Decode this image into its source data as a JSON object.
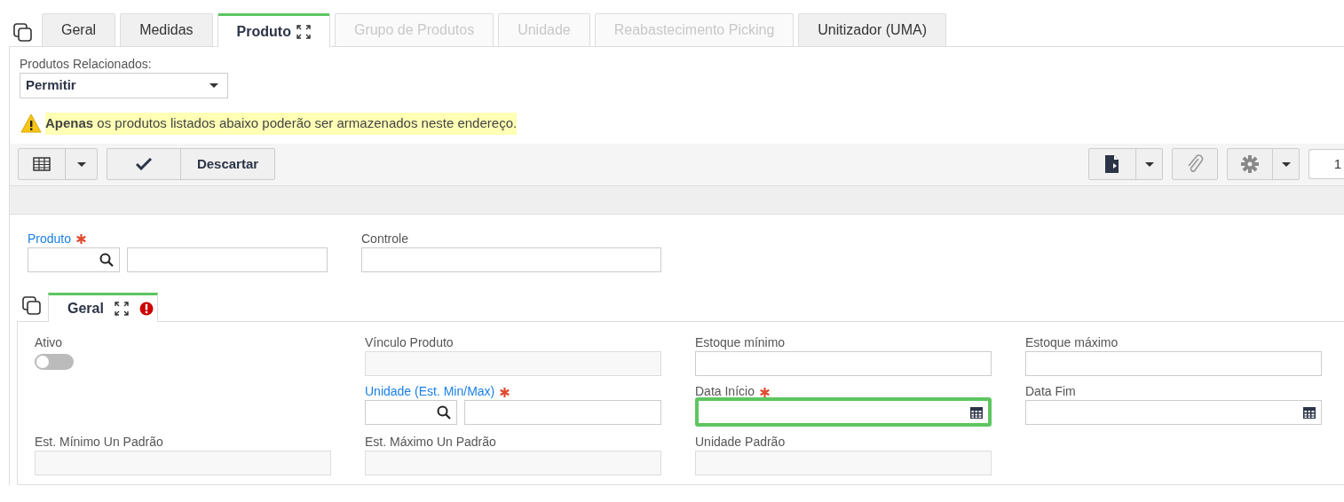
{
  "tabs": [
    {
      "label": "Geral",
      "selected": false,
      "disabled": false
    },
    {
      "label": "Medidas",
      "selected": false,
      "disabled": false
    },
    {
      "label": "Produto",
      "selected": true,
      "disabled": false
    },
    {
      "label": "Grupo de Produtos",
      "selected": false,
      "disabled": true
    },
    {
      "label": "Unidade",
      "selected": false,
      "disabled": true
    },
    {
      "label": "Reabastecimento Picking",
      "selected": false,
      "disabled": true
    },
    {
      "label": "Unitizador (UMA)",
      "selected": false,
      "disabled": false
    }
  ],
  "related": {
    "label": "Produtos Relacionados:",
    "value": "Permitir"
  },
  "warning": "**Apenas** os produtos listados abaixo poderão ser armazenados neste endereço.",
  "toolbar": {
    "discard": "Descartar",
    "page": "1"
  },
  "top_fields": [
    {
      "kind": "lookup",
      "label": "Produto",
      "required": true
    },
    {
      "kind": "text",
      "label": "Controle",
      "required": false
    }
  ],
  "subtabs": [
    {
      "label": "Geral",
      "selected": true,
      "error": true
    }
  ],
  "fields": [
    {
      "kind": "toggle",
      "label": "Ativo",
      "on": false
    },
    {
      "kind": "readonly",
      "label": "Vínculo Produto",
      "required": false
    },
    {
      "kind": "text",
      "label": "Estoque mínimo",
      "required": false
    },
    {
      "kind": "text",
      "label": "Estoque máximo",
      "required": false
    },
    {
      "kind": "lookup",
      "label": "Unidade (Est. Min/Max)",
      "required": true
    },
    {
      "kind": "date",
      "label": "Data Início",
      "required": true,
      "focused": true
    },
    {
      "kind": "date",
      "label": "Data Fim",
      "required": false,
      "focused": false
    },
    {
      "kind": "readonly",
      "label": "Est. Mínimo Un Padrão",
      "required": false
    },
    {
      "kind": "readonly",
      "label": "Est. Máximo Un Padrão",
      "required": false
    },
    {
      "kind": "readonly",
      "label": "Unidade Padrão",
      "required": false
    }
  ]
}
